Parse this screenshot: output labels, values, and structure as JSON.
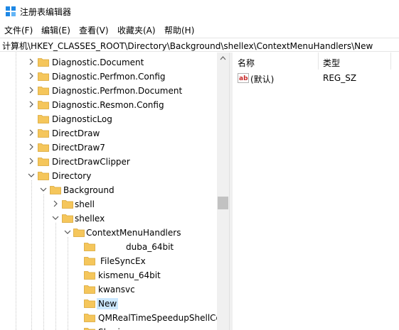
{
  "window": {
    "title": "注册表编辑器",
    "icon": "registry-editor-icon"
  },
  "menu": [
    "文件(F)",
    "编辑(E)",
    "查看(V)",
    "收藏夹(A)",
    "帮助(H)"
  ],
  "address": "计算机\\HKEY_CLASSES_ROOT\\Directory\\Background\\shellex\\ContextMenuHandlers\\New",
  "tree": {
    "items": [
      {
        "label": "Diagnostic.Document",
        "state": "collapsed"
      },
      {
        "label": "Diagnostic.Perfmon.Config",
        "state": "collapsed"
      },
      {
        "label": "Diagnostic.Perfmon.Document",
        "state": "collapsed"
      },
      {
        "label": "Diagnostic.Resmon.Config",
        "state": "collapsed"
      },
      {
        "label": "DiagnosticLog",
        "state": "leaf"
      },
      {
        "label": "DirectDraw",
        "state": "collapsed"
      },
      {
        "label": "DirectDraw7",
        "state": "collapsed"
      },
      {
        "label": "DirectDrawClipper",
        "state": "collapsed"
      },
      {
        "label": "Directory",
        "state": "expanded"
      },
      {
        "label": "Background",
        "state": "expanded"
      },
      {
        "label": "shell",
        "state": "collapsed"
      },
      {
        "label": "shellex",
        "state": "expanded"
      },
      {
        "label": "ContextMenuHandlers",
        "state": "expanded"
      },
      {
        "label": "duba_64bit",
        "state": "leaf"
      },
      {
        "label": "FileSyncEx",
        "state": "leaf"
      },
      {
        "label": "kismenu_64bit",
        "state": "leaf"
      },
      {
        "label": "kwansvc",
        "state": "leaf"
      },
      {
        "label": "New",
        "state": "selected"
      },
      {
        "label": "QMRealTimeSpeedupShellCo",
        "state": "leaf"
      },
      {
        "label": "Sharing",
        "state": "leaf"
      }
    ]
  },
  "values_pane": {
    "headers": {
      "name": "名称",
      "type": "类型"
    },
    "rows": [
      {
        "icon": "ab-string-value-icon",
        "name": "(默认)",
        "type": "REG_SZ"
      }
    ]
  },
  "colors": {
    "folder": "#f5c65b",
    "selection": "#cce8ff",
    "accent": "#0078d7"
  }
}
